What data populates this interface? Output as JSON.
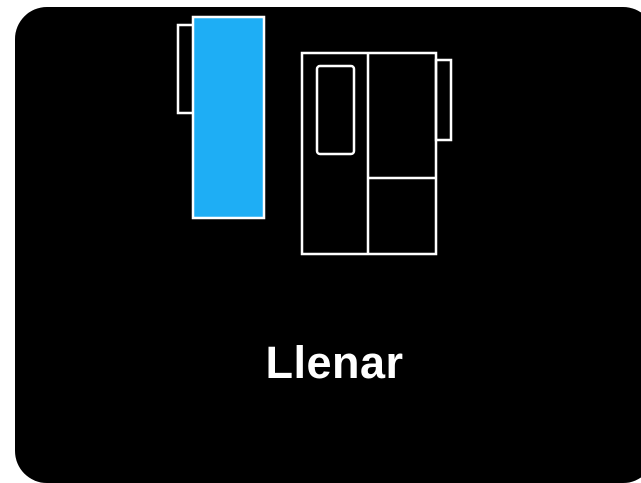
{
  "screen": {
    "mode_label": "Llenar",
    "icons": {
      "pitcher": "pitcher-icon",
      "fridge": "refrigerator-icon"
    }
  },
  "colors": {
    "background": "#000000",
    "accent": "#1EAEF5",
    "outline": "#FFFFFF"
  }
}
